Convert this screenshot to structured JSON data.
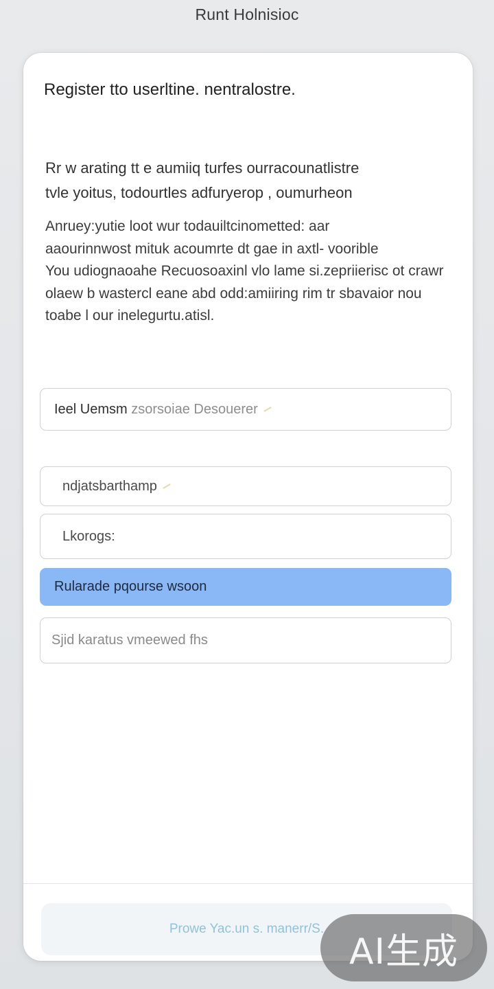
{
  "app": {
    "title": "Runt Holnisioc"
  },
  "card": {
    "header": "Register tto userltine. nentralostre.",
    "intro_lines": [
      "Rr w arating tt e aumiiq turfes ourracounatlistre",
      "tvle yoitus, todourtles adfuryerop , oumurheon"
    ],
    "description_lines": [
      "Anruey:yutie loot wur todauiltcinometted: aar",
      "aaourinnwost mituk acoumrte dt gae in axtl- voorible",
      "You udiognaoahe Recuosoaxinl vlo lame si.zepriierisc ot crawr",
      "olaew b wastercl eane abd odd:amiiring rim tr sbavaior nou",
      "toabe l our inelegurtu.atisl."
    ]
  },
  "form": {
    "fields": [
      {
        "value": "Ieel Uemsm",
        "hint": " zsorsoiae Desouerer"
      },
      {
        "value": "ndjatsbarthamp",
        "hint": ""
      },
      {
        "value": "Lkorogs:",
        "hint": ""
      },
      {
        "value": "Rularade pqourse wsoon",
        "hint": ""
      },
      {
        "value": "Sjid karatus vmeewed fhs",
        "hint": ""
      }
    ],
    "highlight_color": "#8ab8f7"
  },
  "footer": {
    "button_label": "Prowe Yac.un s. manerr/S."
  },
  "watermark": {
    "text": "AI生成"
  }
}
